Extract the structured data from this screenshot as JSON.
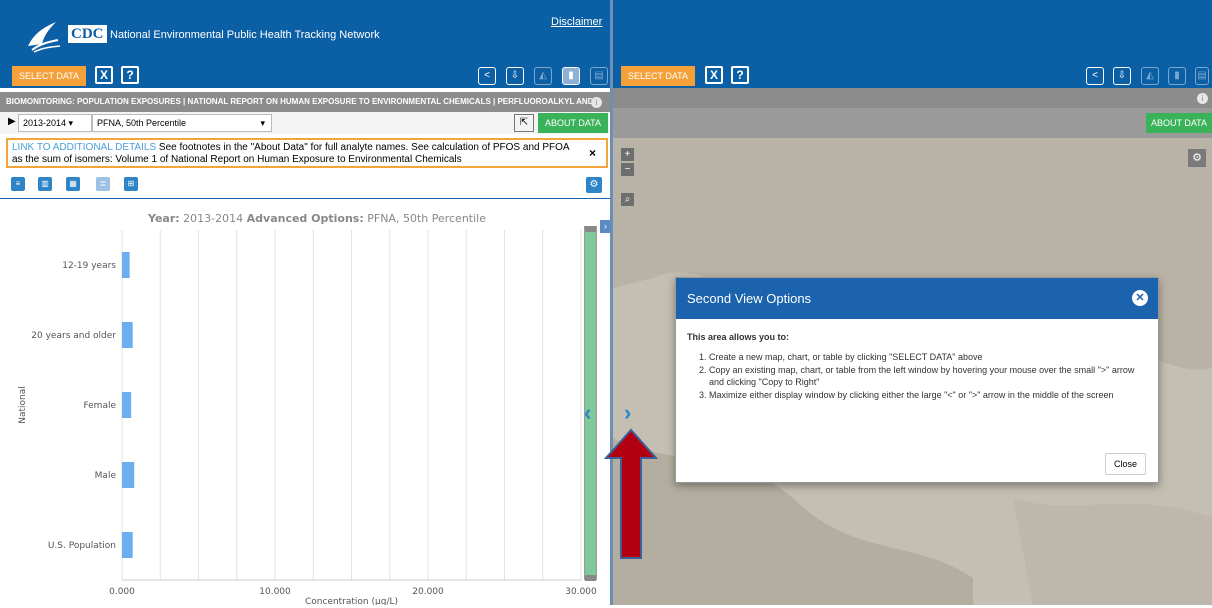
{
  "app": {
    "title": "National Environmental Public Health Tracking Network",
    "logo_text": "CDC",
    "disclaimer": "Disclaimer"
  },
  "left": {
    "select_data": "SELECT DATA",
    "clear_btn": "X",
    "help_btn": "?",
    "breadcrumb": "BIOMONITORING: POPULATION EXPOSURES | NATIONAL REPORT ON HUMAN EXPOSURE TO ENVIRONMENTAL CHEMICALS | PERFLUOROALKYL AND...",
    "year_select": "2013-2014",
    "measure_select": "PFNA, 50th Percentile",
    "about_data": "ABOUT DATA",
    "notice": {
      "link": "LINK TO ADDITIONAL DETAILS",
      "text": " See footnotes in the \"About Data\" for full analyte names. See calculation of PFOS and PFOA as the sum of isomers: Volume 1 of National Report on Human Exposure to Environmental Chemicals",
      "close": "×"
    },
    "chart_title_year_label": "Year:",
    "chart_title_year": "2013-2014",
    "chart_title_adv_label": "Advanced Options:",
    "chart_title_adv": "PFNA, 50th Percentile"
  },
  "right": {
    "select_data": "SELECT DATA",
    "clear_btn": "X",
    "help_btn": "?",
    "about_data": "ABOUT DATA"
  },
  "modal": {
    "title": "Second View Options",
    "intro": "This area allows you to:",
    "items": [
      "Create a new map, chart, or table by clicking \"SELECT DATA\" above",
      "Copy an existing map, chart, or table from the left window by hovering your mouse over the small \">\" arrow and clicking \"Copy to Right\"",
      "Maximize either display window by clicking either the large \"<\" or \">\" arrow in the middle of the screen"
    ],
    "close": "Close"
  },
  "chart_data": {
    "type": "bar",
    "orientation": "horizontal",
    "categories": [
      "12-19 years",
      "20 years and older",
      "Female",
      "Male",
      "U.S. Population"
    ],
    "values": [
      0.5,
      0.7,
      0.6,
      0.8,
      0.7
    ],
    "ylabel": "National",
    "xlabel": "Concentration (µg/L)",
    "xticks": [
      "0.000",
      "10.000",
      "20.000",
      "30.000"
    ],
    "xlim": [
      0,
      30
    ],
    "bar_color": "#6ab0f0",
    "grid": true
  },
  "colors": {
    "brand_blue": "#0b5fa5",
    "orange": "#f4a13a",
    "green": "#3ab25a",
    "arrow_red": "#b30010"
  }
}
